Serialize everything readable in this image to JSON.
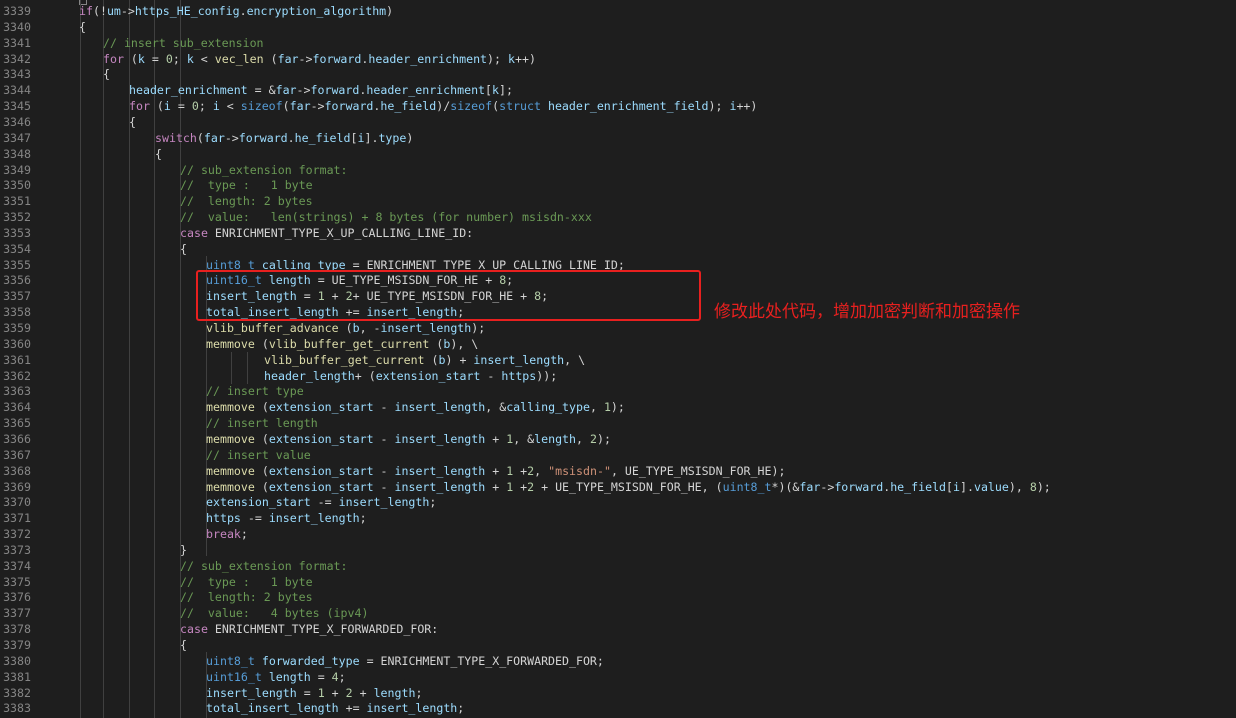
{
  "annotation": "修改此处代码，增加加密判断和加密操作",
  "lines": [
    {
      "n": "3339",
      "indent": 1,
      "parts": [
        [
          "kw",
          "if"
        ],
        [
          "p",
          "(!"
        ],
        [
          "var",
          "um"
        ],
        [
          "p",
          "->"
        ],
        [
          "var",
          "https_HE_config"
        ],
        [
          "p",
          "."
        ],
        [
          "var",
          "encryption_algorithm"
        ],
        [
          "p",
          ")"
        ]
      ]
    },
    {
      "n": "3340",
      "indent": 1,
      "parts": [
        [
          "p",
          "{"
        ]
      ]
    },
    {
      "n": "3341",
      "indent": 2,
      "parts": [
        [
          "cm",
          "// insert sub_extension"
        ]
      ]
    },
    {
      "n": "3342",
      "indent": 2,
      "parts": [
        [
          "kw",
          "for"
        ],
        [
          "p",
          " ("
        ],
        [
          "var",
          "k"
        ],
        [
          "p",
          " = "
        ],
        [
          "num",
          "0"
        ],
        [
          "p",
          "; "
        ],
        [
          "var",
          "k"
        ],
        [
          "p",
          " < "
        ],
        [
          "fn",
          "vec_len"
        ],
        [
          "p",
          " ("
        ],
        [
          "var",
          "far"
        ],
        [
          "p",
          "->"
        ],
        [
          "var",
          "forward"
        ],
        [
          "p",
          "."
        ],
        [
          "var",
          "header_enrichment"
        ],
        [
          "p",
          "); "
        ],
        [
          "var",
          "k"
        ],
        [
          "p",
          "++)"
        ]
      ]
    },
    {
      "n": "3343",
      "indent": 2,
      "parts": [
        [
          "p",
          "{"
        ]
      ]
    },
    {
      "n": "3344",
      "indent": 3,
      "parts": [
        [
          "var",
          "header_enrichment"
        ],
        [
          "p",
          " = &"
        ],
        [
          "var",
          "far"
        ],
        [
          "p",
          "->"
        ],
        [
          "var",
          "forward"
        ],
        [
          "p",
          "."
        ],
        [
          "var",
          "header_enrichment"
        ],
        [
          "p",
          "["
        ],
        [
          "var",
          "k"
        ],
        [
          "p",
          "];"
        ]
      ]
    },
    {
      "n": "3345",
      "indent": 3,
      "parts": [
        [
          "kw",
          "for"
        ],
        [
          "p",
          " ("
        ],
        [
          "var",
          "i"
        ],
        [
          "p",
          " = "
        ],
        [
          "num",
          "0"
        ],
        [
          "p",
          "; "
        ],
        [
          "var",
          "i"
        ],
        [
          "p",
          " < "
        ],
        [
          "ty",
          "sizeof"
        ],
        [
          "p",
          "("
        ],
        [
          "var",
          "far"
        ],
        [
          "p",
          "->"
        ],
        [
          "var",
          "forward"
        ],
        [
          "p",
          "."
        ],
        [
          "var",
          "he_field"
        ],
        [
          "p",
          ")/"
        ],
        [
          "ty",
          "sizeof"
        ],
        [
          "p",
          "("
        ],
        [
          "ty",
          "struct"
        ],
        [
          "p",
          " "
        ],
        [
          "ty2",
          "header_enrichment_field"
        ],
        [
          "p",
          "); "
        ],
        [
          "var",
          "i"
        ],
        [
          "p",
          "++)"
        ]
      ]
    },
    {
      "n": "3346",
      "indent": 3,
      "parts": [
        [
          "p",
          "{"
        ]
      ]
    },
    {
      "n": "3347",
      "indent": 4,
      "parts": [
        [
          "kw",
          "switch"
        ],
        [
          "p",
          "("
        ],
        [
          "var",
          "far"
        ],
        [
          "p",
          "->"
        ],
        [
          "var",
          "forward"
        ],
        [
          "p",
          "."
        ],
        [
          "var",
          "he_field"
        ],
        [
          "p",
          "["
        ],
        [
          "var",
          "i"
        ],
        [
          "p",
          "]."
        ],
        [
          "var",
          "type"
        ],
        [
          "p",
          ")"
        ]
      ]
    },
    {
      "n": "3348",
      "indent": 4,
      "parts": [
        [
          "p",
          "{"
        ]
      ]
    },
    {
      "n": "3349",
      "indent": 5,
      "parts": [
        [
          "cm",
          "// sub_extension format:"
        ]
      ]
    },
    {
      "n": "3350",
      "indent": 5,
      "parts": [
        [
          "cm",
          "//  type :   1 byte"
        ]
      ]
    },
    {
      "n": "3351",
      "indent": 5,
      "parts": [
        [
          "cm",
          "//  length: 2 bytes"
        ]
      ]
    },
    {
      "n": "3352",
      "indent": 5,
      "parts": [
        [
          "cm",
          "//  value:   len(strings) + 8 bytes (for number) msisdn-xxx"
        ]
      ]
    },
    {
      "n": "3353",
      "indent": 5,
      "parts": [
        [
          "kw",
          "case"
        ],
        [
          "p",
          " ENRICHMENT_TYPE_X_UP_CALLING_LINE_ID:"
        ]
      ]
    },
    {
      "n": "3354",
      "indent": 5,
      "parts": [
        [
          "p",
          "{"
        ]
      ]
    },
    {
      "n": "3355",
      "indent": 6,
      "parts": [
        [
          "ty",
          "uint8_t"
        ],
        [
          "p",
          " "
        ],
        [
          "var",
          "calling_type"
        ],
        [
          "p",
          " = ENRICHMENT_TYPE_X_UP_CALLING_LINE_ID;"
        ]
      ]
    },
    {
      "n": "3356",
      "indent": 6,
      "parts": [
        [
          "ty",
          "uint16_t"
        ],
        [
          "p",
          " "
        ],
        [
          "var",
          "length"
        ],
        [
          "p",
          " = UE_TYPE_MSISDN_FOR_HE + "
        ],
        [
          "num",
          "8"
        ],
        [
          "p",
          ";"
        ]
      ]
    },
    {
      "n": "3357",
      "indent": 6,
      "parts": [
        [
          "var",
          "insert_length"
        ],
        [
          "p",
          " = "
        ],
        [
          "num",
          "1"
        ],
        [
          "p",
          " + "
        ],
        [
          "num",
          "2"
        ],
        [
          "p",
          "+ UE_TYPE_MSISDN_FOR_HE + "
        ],
        [
          "num",
          "8"
        ],
        [
          "p",
          ";"
        ]
      ]
    },
    {
      "n": "3358",
      "indent": 6,
      "parts": [
        [
          "var",
          "total_insert_length"
        ],
        [
          "p",
          " += "
        ],
        [
          "var",
          "insert_length"
        ],
        [
          "p",
          ";"
        ]
      ]
    },
    {
      "n": "3359",
      "indent": 6,
      "parts": [
        [
          "fn",
          "vlib_buffer_advance"
        ],
        [
          "p",
          " ("
        ],
        [
          "var",
          "b"
        ],
        [
          "p",
          ", -"
        ],
        [
          "var",
          "insert_length"
        ],
        [
          "p",
          ");"
        ]
      ]
    },
    {
      "n": "3360",
      "indent": 6,
      "parts": [
        [
          "fn",
          "memmove"
        ],
        [
          "p",
          " ("
        ],
        [
          "fn",
          "vlib_buffer_get_current"
        ],
        [
          "p",
          " ("
        ],
        [
          "var",
          "b"
        ],
        [
          "p",
          "), \\"
        ]
      ]
    },
    {
      "n": "3361",
      "indent": 8,
      "parts": [
        [
          "fn",
          "vlib_buffer_get_current"
        ],
        [
          "p",
          " ("
        ],
        [
          "var",
          "b"
        ],
        [
          "p",
          ") + "
        ],
        [
          "var",
          "insert_length"
        ],
        [
          "p",
          ", \\"
        ]
      ]
    },
    {
      "n": "3362",
      "indent": 8,
      "parts": [
        [
          "var",
          "header_length"
        ],
        [
          "p",
          "+ ("
        ],
        [
          "var",
          "extension_start"
        ],
        [
          "p",
          " - "
        ],
        [
          "var",
          "https"
        ],
        [
          "p",
          "));"
        ]
      ]
    },
    {
      "n": "3363",
      "indent": 6,
      "parts": [
        [
          "cm",
          "// insert type"
        ]
      ]
    },
    {
      "n": "3364",
      "indent": 6,
      "parts": [
        [
          "fn",
          "memmove"
        ],
        [
          "p",
          " ("
        ],
        [
          "var",
          "extension_start"
        ],
        [
          "p",
          " - "
        ],
        [
          "var",
          "insert_length"
        ],
        [
          "p",
          ", &"
        ],
        [
          "var",
          "calling_type"
        ],
        [
          "p",
          ", "
        ],
        [
          "num",
          "1"
        ],
        [
          "p",
          ");"
        ]
      ]
    },
    {
      "n": "3365",
      "indent": 6,
      "parts": [
        [
          "cm",
          "// insert length"
        ]
      ]
    },
    {
      "n": "3366",
      "indent": 6,
      "parts": [
        [
          "fn",
          "memmove"
        ],
        [
          "p",
          " ("
        ],
        [
          "var",
          "extension_start"
        ],
        [
          "p",
          " - "
        ],
        [
          "var",
          "insert_length"
        ],
        [
          "p",
          " + "
        ],
        [
          "num",
          "1"
        ],
        [
          "p",
          ", &"
        ],
        [
          "var",
          "length"
        ],
        [
          "p",
          ", "
        ],
        [
          "num",
          "2"
        ],
        [
          "p",
          ");"
        ]
      ]
    },
    {
      "n": "3367",
      "indent": 6,
      "parts": [
        [
          "cm",
          "// insert value"
        ]
      ]
    },
    {
      "n": "3368",
      "indent": 6,
      "parts": [
        [
          "fn",
          "memmove"
        ],
        [
          "p",
          " ("
        ],
        [
          "var",
          "extension_start"
        ],
        [
          "p",
          " - "
        ],
        [
          "var",
          "insert_length"
        ],
        [
          "p",
          " + "
        ],
        [
          "num",
          "1"
        ],
        [
          "p",
          " +"
        ],
        [
          "num",
          "2"
        ],
        [
          "p",
          ", "
        ],
        [
          "str",
          "\"msisdn-\""
        ],
        [
          "p",
          ", UE_TYPE_MSISDN_FOR_HE);"
        ]
      ]
    },
    {
      "n": "3369",
      "indent": 6,
      "parts": [
        [
          "fn",
          "memmove"
        ],
        [
          "p",
          " ("
        ],
        [
          "var",
          "extension_start"
        ],
        [
          "p",
          " - "
        ],
        [
          "var",
          "insert_length"
        ],
        [
          "p",
          " + "
        ],
        [
          "num",
          "1"
        ],
        [
          "p",
          " +"
        ],
        [
          "num",
          "2"
        ],
        [
          "p",
          " + UE_TYPE_MSISDN_FOR_HE, ("
        ],
        [
          "ty",
          "uint8_t"
        ],
        [
          "p",
          "*)(&"
        ],
        [
          "var",
          "far"
        ],
        [
          "p",
          "->"
        ],
        [
          "var",
          "forward"
        ],
        [
          "p",
          "."
        ],
        [
          "var",
          "he_field"
        ],
        [
          "p",
          "["
        ],
        [
          "var",
          "i"
        ],
        [
          "p",
          "]."
        ],
        [
          "var",
          "value"
        ],
        [
          "p",
          "), "
        ],
        [
          "num",
          "8"
        ],
        [
          "p",
          ");"
        ]
      ]
    },
    {
      "n": "3370",
      "indent": 6,
      "parts": [
        [
          "var",
          "extension_start"
        ],
        [
          "p",
          " -= "
        ],
        [
          "var",
          "insert_length"
        ],
        [
          "p",
          ";"
        ]
      ]
    },
    {
      "n": "3371",
      "indent": 6,
      "parts": [
        [
          "var",
          "https"
        ],
        [
          "p",
          " -= "
        ],
        [
          "var",
          "insert_length"
        ],
        [
          "p",
          ";"
        ]
      ]
    },
    {
      "n": "3372",
      "indent": 6,
      "parts": [
        [
          "kw",
          "break"
        ],
        [
          "p",
          ";"
        ]
      ]
    },
    {
      "n": "3373",
      "indent": 5,
      "parts": [
        [
          "p",
          "}"
        ]
      ]
    },
    {
      "n": "3374",
      "indent": 5,
      "parts": [
        [
          "cm",
          "// sub_extension format:"
        ]
      ]
    },
    {
      "n": "3375",
      "indent": 5,
      "parts": [
        [
          "cm",
          "//  type :   1 byte"
        ]
      ]
    },
    {
      "n": "3376",
      "indent": 5,
      "parts": [
        [
          "cm",
          "//  length: 2 bytes"
        ]
      ]
    },
    {
      "n": "3377",
      "indent": 5,
      "parts": [
        [
          "cm",
          "//  value:   4 bytes (ipv4)"
        ]
      ]
    },
    {
      "n": "3378",
      "indent": 5,
      "parts": [
        [
          "kw",
          "case"
        ],
        [
          "p",
          " ENRICHMENT_TYPE_X_FORWARDED_FOR:"
        ]
      ]
    },
    {
      "n": "3379",
      "indent": 5,
      "parts": [
        [
          "p",
          "{"
        ]
      ]
    },
    {
      "n": "3380",
      "indent": 6,
      "parts": [
        [
          "ty",
          "uint8_t"
        ],
        [
          "p",
          " "
        ],
        [
          "var",
          "forwarded_type"
        ],
        [
          "p",
          " = ENRICHMENT_TYPE_X_FORWARDED_FOR;"
        ]
      ]
    },
    {
      "n": "3381",
      "indent": 6,
      "parts": [
        [
          "ty",
          "uint16_t"
        ],
        [
          "p",
          " "
        ],
        [
          "var",
          "length"
        ],
        [
          "p",
          " = "
        ],
        [
          "num",
          "4"
        ],
        [
          "p",
          ";"
        ]
      ]
    },
    {
      "n": "3382",
      "indent": 6,
      "parts": [
        [
          "var",
          "insert_length"
        ],
        [
          "p",
          " = "
        ],
        [
          "num",
          "1"
        ],
        [
          "p",
          " + "
        ],
        [
          "num",
          "2"
        ],
        [
          "p",
          " + "
        ],
        [
          "var",
          "length"
        ],
        [
          "p",
          ";"
        ]
      ]
    },
    {
      "n": "3383",
      "indent": 6,
      "parts": [
        [
          "var",
          "total_insert_length"
        ],
        [
          "p",
          " += "
        ],
        [
          "var",
          "insert_length"
        ],
        [
          "p",
          ";"
        ]
      ]
    }
  ]
}
